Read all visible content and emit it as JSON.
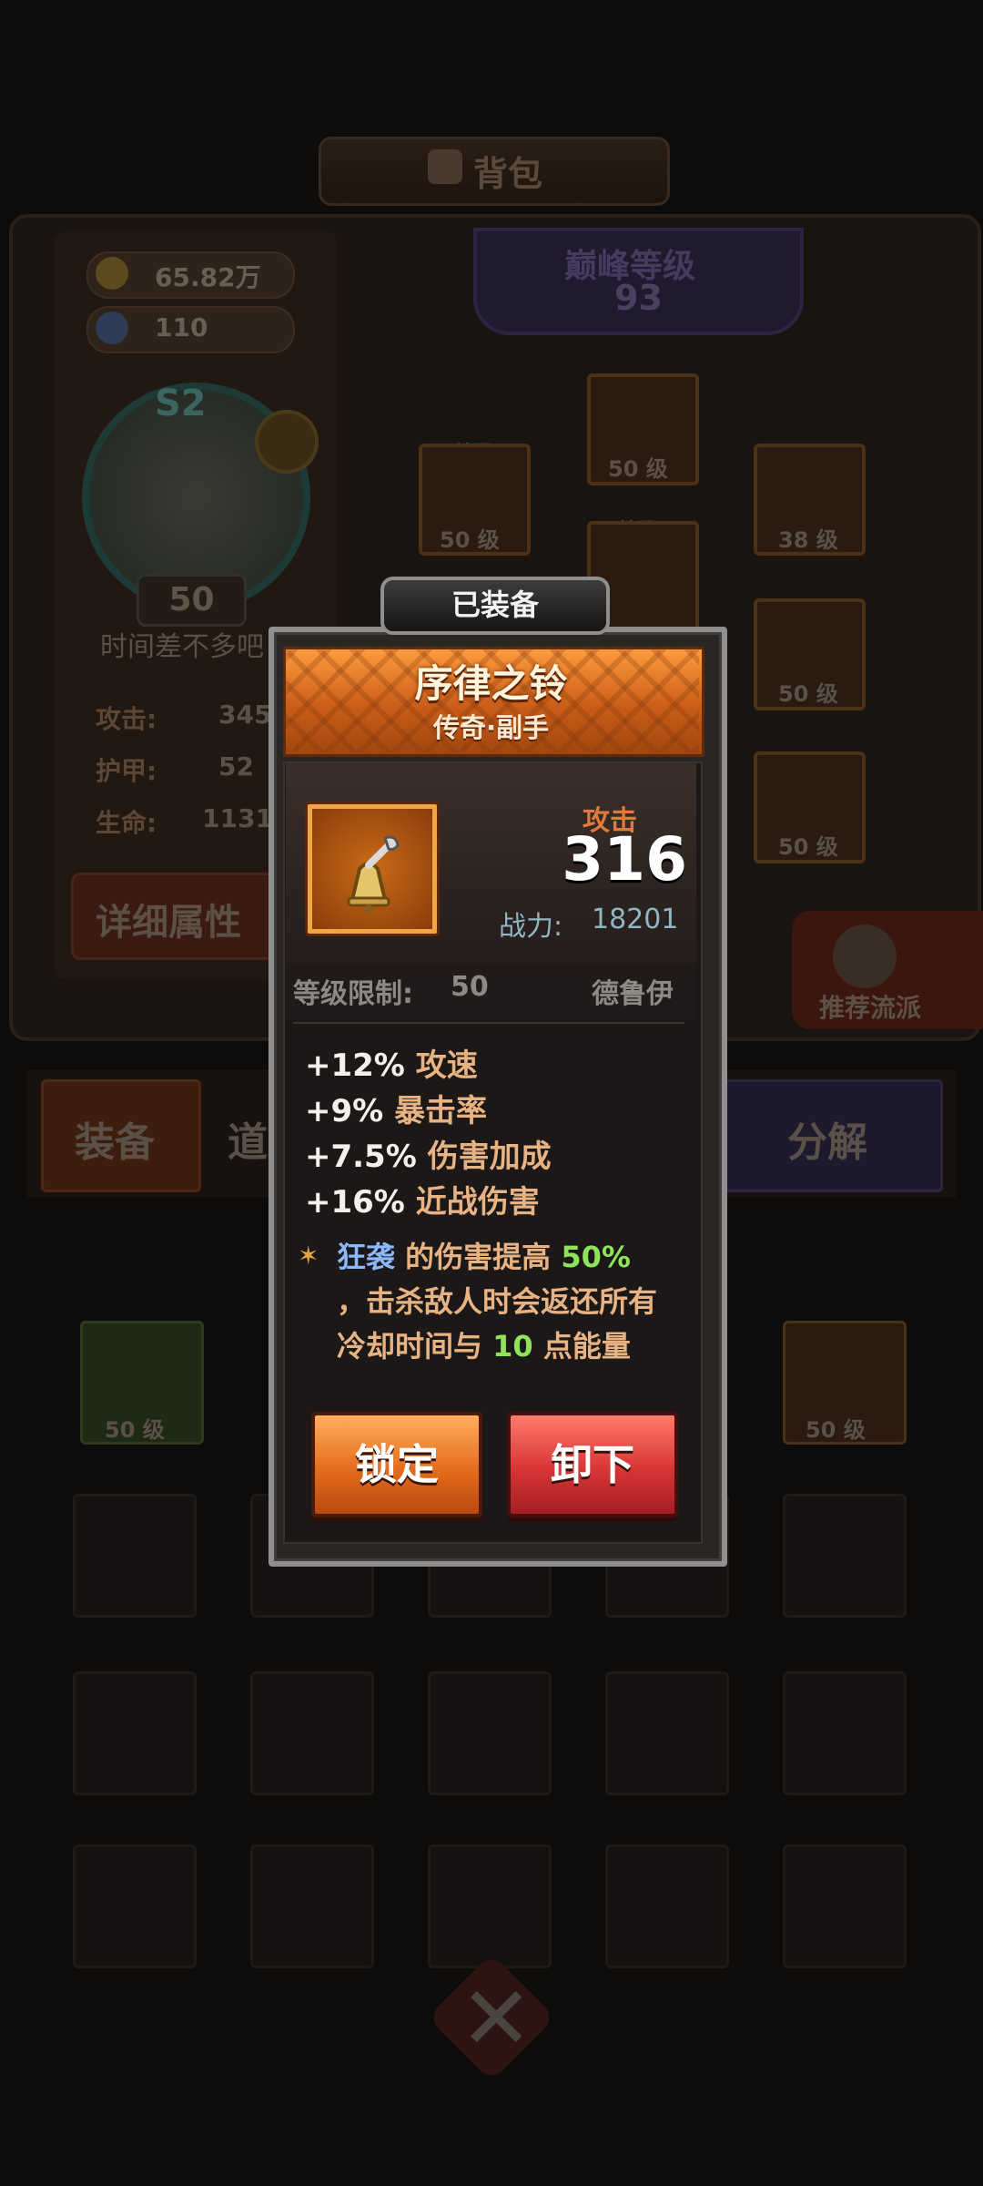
{
  "screen": {
    "title": "背包"
  },
  "player": {
    "gold": "65.82万",
    "gems": "110",
    "rank": "S2",
    "level": "50",
    "name": "时间差不多吧",
    "stats": [
      {
        "label": "攻击:",
        "value": "345"
      },
      {
        "label": "护甲:",
        "value": "52"
      },
      {
        "label": "生命:",
        "value": "1131"
      }
    ],
    "detail_button": "详细属性"
  },
  "peak": {
    "label": "巅峰等级",
    "value": "93"
  },
  "gear_slots": {
    "tag": "神赐",
    "levels": [
      "50 级",
      "50 级",
      "38 级",
      "50 级",
      "50 级",
      "50 级"
    ]
  },
  "recommend_button": "推荐流派",
  "tabs": {
    "equip": "装备",
    "items": "道",
    "decompose": "分解"
  },
  "inventory": {
    "levels": [
      "50 级",
      "50 级"
    ]
  },
  "popup": {
    "status_tab": "已装备",
    "item_name": "序律之铃",
    "item_type": "传奇·副手",
    "main_stat_label": "攻击",
    "main_stat_value": "316",
    "power_label": "战力:",
    "power_value": "18201",
    "level_limit_label": "等级限制:",
    "level_limit_value": "50",
    "class": "德鲁伊",
    "stat_lines": [
      {
        "value": "+12%",
        "name": "攻速"
      },
      {
        "value": "+9%",
        "name": "暴击率"
      },
      {
        "value": "+7.5%",
        "name": "伤害加成"
      },
      {
        "value": "+16%",
        "name": "近战伤害"
      }
    ],
    "effect": {
      "skill": "狂袭",
      "text1": "的伤害提高",
      "pct": "50%",
      "text2": "，击杀敌人时会返还所有",
      "text3": "冷却时间与",
      "energy": "10",
      "text4": "点能量"
    },
    "lock_button": "锁定",
    "unequip_button": "卸下"
  },
  "colors": {
    "header_orange": "#d66a1e",
    "attack_label": "#e07a3a",
    "highlight_green": "#8ee35b",
    "highlight_blue": "#8bb8ff",
    "lock_button": "#e56c1c",
    "unequip_button": "#d63535"
  }
}
